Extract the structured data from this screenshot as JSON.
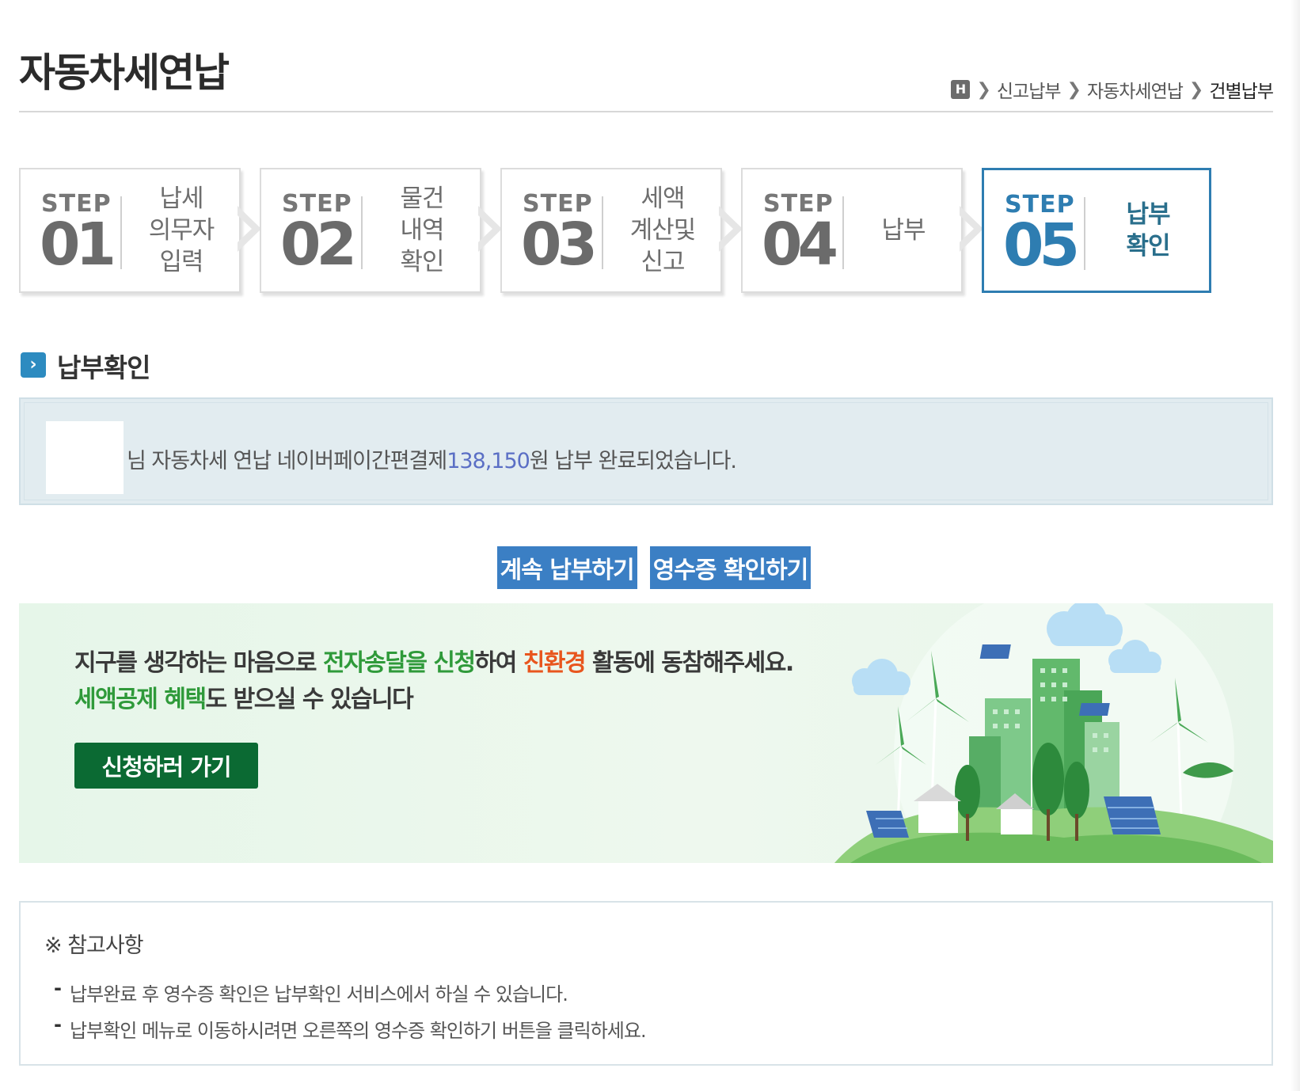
{
  "header": {
    "title": "자동차세연납",
    "breadcrumb": {
      "home_icon": "H",
      "items": [
        "신고납부",
        "자동차세연납",
        "건별납부"
      ]
    }
  },
  "steps": [
    {
      "label": "STEP",
      "number": "01",
      "name": "납세\n의무자\n입력",
      "active": false
    },
    {
      "label": "STEP",
      "number": "02",
      "name": "물건\n내역\n확인",
      "active": false
    },
    {
      "label": "STEP",
      "number": "03",
      "name": "세액\n계산및\n신고",
      "active": false
    },
    {
      "label": "STEP",
      "number": "04",
      "name": "납부",
      "active": false
    },
    {
      "label": "STEP",
      "number": "05",
      "name": "납부\n확인",
      "active": true
    }
  ],
  "section": {
    "icon": "chevron-right-icon",
    "title": "납부확인"
  },
  "result": {
    "text_prefix": "님 자동차세 연납 네이버페이간편결제",
    "amount": "138,150",
    "text_suffix": "원 납부 완료되었습니다."
  },
  "actions": {
    "continue_label": "계속 납부하기",
    "receipt_label": "영수증 확인하기"
  },
  "banner": {
    "line1_a": "지구를 생각하는 마음으로 ",
    "line1_b": "전자송달을 신청",
    "line1_c": "하여 ",
    "line1_d": "친환경",
    "line1_e": " 활동에 동참해주세요.",
    "line2_a": "세액공제 혜택",
    "line2_b": "도 받으실 수 있습니다",
    "button_label": "신청하러 가기"
  },
  "notes": {
    "title": "※ 참고사항",
    "items": [
      "납부완료 후 영수증 확인은 납부확인 서비스에서 하실 수 있습니다.",
      "납부확인 메뉴로 이동하시려면 오른쪽의 영수증 확인하기 버튼을 클릭하세요."
    ]
  },
  "colors": {
    "accent": "#2e7db1",
    "button": "#3b7fc4",
    "banner_button": "#0b6a33",
    "highlight_green": "#2f9a3a",
    "highlight_orange": "#e8561e",
    "amount": "#5b6fc5"
  }
}
